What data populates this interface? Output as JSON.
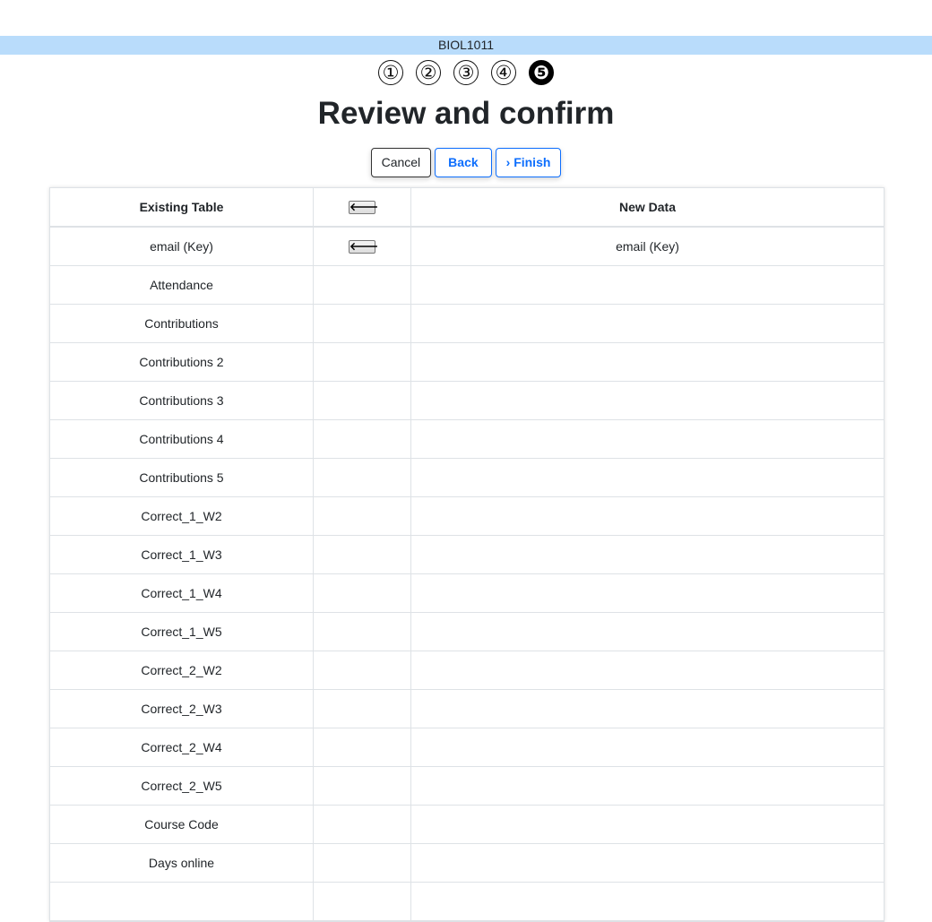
{
  "course": {
    "code": "BIOL1011"
  },
  "steps": [
    {
      "label": "①",
      "active": false
    },
    {
      "label": "②",
      "active": false
    },
    {
      "label": "③",
      "active": false
    },
    {
      "label": "④",
      "active": false
    },
    {
      "label": "❺",
      "active": true
    }
  ],
  "page": {
    "title": "Review and confirm"
  },
  "buttons": {
    "cancel": "Cancel",
    "back": "Back",
    "finish": "› Finish"
  },
  "table": {
    "headers": {
      "existing": "Existing Table",
      "arrow_icon": "left-arrow-icon",
      "new": "New Data"
    },
    "arrow_glyph": "🡐",
    "rows": [
      {
        "existing": "email (Key)",
        "mapped": true,
        "new": "email (Key)"
      },
      {
        "existing": "Attendance",
        "mapped": false,
        "new": ""
      },
      {
        "existing": "Contributions",
        "mapped": false,
        "new": ""
      },
      {
        "existing": "Contributions 2",
        "mapped": false,
        "new": ""
      },
      {
        "existing": "Contributions 3",
        "mapped": false,
        "new": ""
      },
      {
        "existing": "Contributions 4",
        "mapped": false,
        "new": ""
      },
      {
        "existing": "Contributions 5",
        "mapped": false,
        "new": ""
      },
      {
        "existing": "Correct_1_W2",
        "mapped": false,
        "new": ""
      },
      {
        "existing": "Correct_1_W3",
        "mapped": false,
        "new": ""
      },
      {
        "existing": "Correct_1_W4",
        "mapped": false,
        "new": ""
      },
      {
        "existing": "Correct_1_W5",
        "mapped": false,
        "new": ""
      },
      {
        "existing": "Correct_2_W2",
        "mapped": false,
        "new": ""
      },
      {
        "existing": "Correct_2_W3",
        "mapped": false,
        "new": ""
      },
      {
        "existing": "Correct_2_W4",
        "mapped": false,
        "new": ""
      },
      {
        "existing": "Correct_2_W5",
        "mapped": false,
        "new": ""
      },
      {
        "existing": "Course Code",
        "mapped": false,
        "new": ""
      },
      {
        "existing": "Days online",
        "mapped": false,
        "new": ""
      },
      {
        "existing": "",
        "mapped": false,
        "new": ""
      }
    ]
  },
  "colors": {
    "course_bar": "#b9dcfb",
    "primary": "#0d6efd",
    "border": "#dee2e6"
  }
}
